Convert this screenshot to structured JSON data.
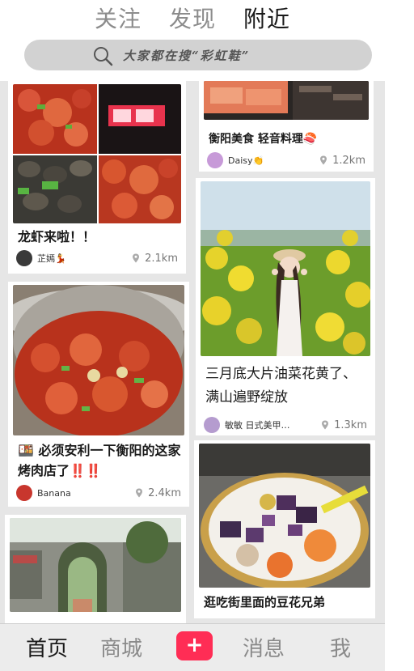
{
  "top_tabs": {
    "follow": "关注",
    "discover": "发现",
    "nearby": "附近"
  },
  "search": {
    "placeholder": "大家都在搜“彩虹鞋”"
  },
  "colors": {
    "accent": "#ff2d55",
    "feed_bg": "#e6e6e6"
  },
  "feed": {
    "left": [
      {
        "title": "龙虾来啦！！",
        "author": "芷嫣💃",
        "distance": "2.1km"
      },
      {
        "title": "🍱 必须安利一下衡阳的这家烤肉店了‼️‼️",
        "author": "Banana",
        "distance": "2.4km"
      },
      {
        "title": "",
        "author": "",
        "distance": ""
      }
    ],
    "right": [
      {
        "title": "衡阳美食 轻音料理🍣",
        "author": "Daisy👏",
        "distance": "1.2km"
      },
      {
        "title": "三月底大片油菜花黄了、满山遍野绽放",
        "author": "敏敏 日式美甲…",
        "distance": "1.3km"
      },
      {
        "title": "逛吃街里面的豆花兄弟",
        "author": "",
        "distance": ""
      }
    ]
  },
  "bottom_nav": {
    "home": "首页",
    "mall": "商城",
    "add": "+",
    "messages": "消息",
    "me": "我"
  }
}
